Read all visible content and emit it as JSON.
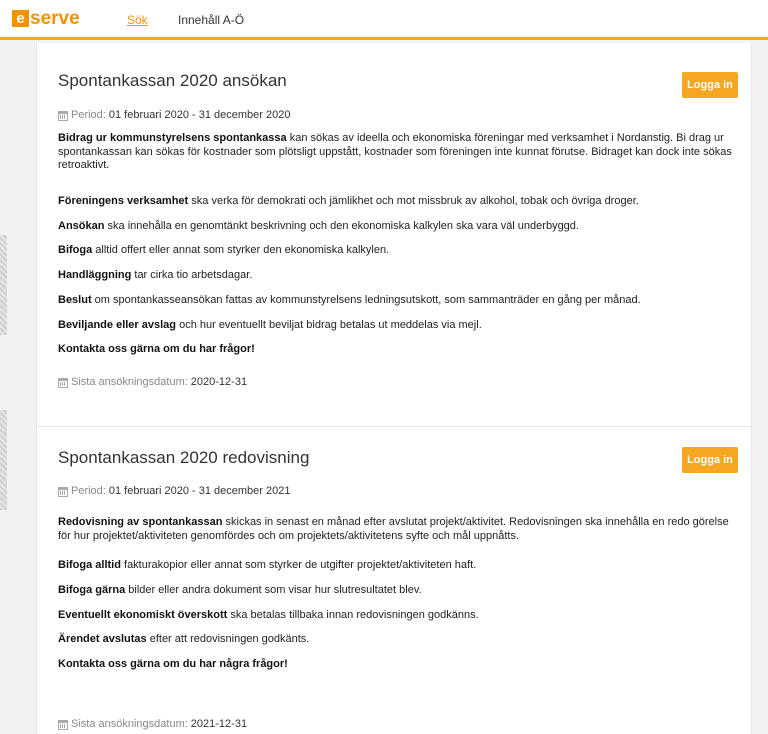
{
  "header": {
    "logo_e": "e",
    "logo_rest": "serve",
    "nav": {
      "sok": "Sök",
      "innehall": "Innehåll A-Ö"
    }
  },
  "cards": [
    {
      "title": "Spontankassan 2020 ansökan",
      "login_label": "Logga in",
      "period_label": "Period:",
      "period_value": "01 februari 2020 - 31 december 2020",
      "paragraphs": [
        {
          "bold": "Bidrag ur kommunstyrelsens spontankassa",
          "text": " kan sökas av ideella och ekonomiska föreningar med verksamhet i Nordanstig. Bi drag ur spontankassan kan sökas för kostnader som plötsligt uppstått, kostnader som föreningen inte kunnat förutse. Bidraget kan dock inte sökas retroaktivt."
        },
        {
          "bold": "Föreningens verksamhet",
          "text": " ska verka för demokrati och jämlikhet och mot missbruk av alkohol, tobak och övriga droger."
        },
        {
          "bold": "Ansökan",
          "text": " ska innehålla en genomtänkt beskrivning och den ekonomiska kalkylen ska vara väl underbyggd."
        },
        {
          "bold": "Bifoga",
          "text": " alltid offert eller annat som styrker den ekonomiska kalkylen."
        },
        {
          "bold": "Handläggning",
          "text": " tar cirka tio arbetsdagar."
        },
        {
          "bold": "Beslut",
          "text": " om spontankasseansökan fattas av kommunstyrelsens ledningsutskott, som sammanträder en gång per månad."
        },
        {
          "bold": "Beviljande eller avslag",
          "text": " och hur eventuellt beviljat bidrag betalas ut meddelas via mejl."
        },
        {
          "bold": "Kontakta oss gärna om du har frågor!",
          "text": ""
        }
      ],
      "deadline_label": "Sista ansökningsdatum:",
      "deadline_value": "2020-12-31"
    },
    {
      "title": "Spontankassan 2020 redovisning",
      "login_label": "Logga in",
      "period_label": "Period:",
      "period_value": "01 februari 2020 - 31 december 2021",
      "paragraphs": [
        {
          "bold": "Redovisning av spontankassan",
          "text": " skickas in senast en månad efter avslutat projekt/aktivitet. Redovisningen ska innehålla en redo görelse för hur projektet/aktiviteten genomfördes och om projektets/aktivitetens syfte och mål uppnåtts."
        },
        {
          "bold": "Bifoga alltid",
          "text": " fakturakopior eller annat som styrker de utgifter projektet/aktiviteten haft."
        },
        {
          "bold": "Bifoga gärna",
          "text": " bilder eller andra dokument som visar hur slutresultatet blev."
        },
        {
          "bold": "Eventuellt ekonomiskt överskott",
          "text": " ska betalas tillbaka innan redovisningen godkänns."
        },
        {
          "bold": "Ärendet avslutas",
          "text": " efter att redovisningen godkänts."
        },
        {
          "bold": "Kontakta oss gärna om du har några frågor!",
          "text": ""
        }
      ],
      "deadline_label": "Sista ansökningsdatum:",
      "deadline_value": "2021-12-31"
    }
  ]
}
